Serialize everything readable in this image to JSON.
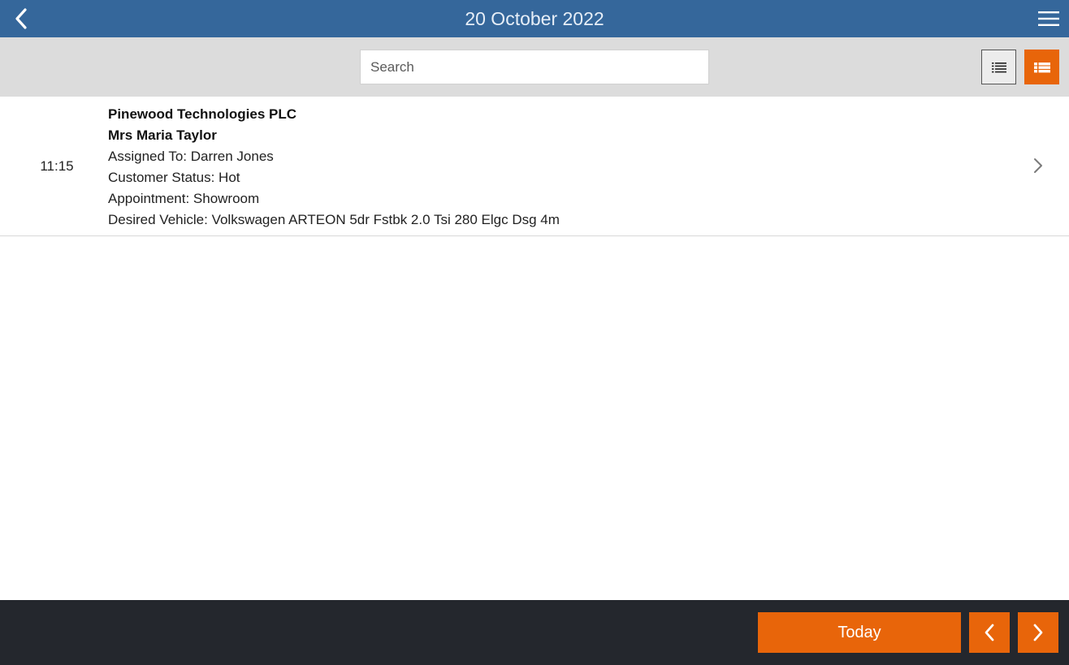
{
  "header": {
    "title": "20 October 2022",
    "back_icon": "chevron-left-icon",
    "menu_icon": "hamburger-menu-icon",
    "color": "#35679b"
  },
  "toolbar": {
    "search_placeholder": "Search",
    "list_view_icon": "compact-list-icon",
    "detail_view_icon": "detail-list-icon",
    "active_view": "detail",
    "accent_color": "#e8650a"
  },
  "appointments": [
    {
      "time": "11:15",
      "company": "Pinewood Technologies PLC",
      "customer": "Mrs Maria Taylor",
      "assigned_to": "Assigned To: Darren Jones",
      "customer_status": "Customer Status: Hot",
      "appointment": "Appointment: Showroom",
      "desired_vehicle": "Desired Vehicle: Volkswagen ARTEON 5dr Fstbk 2.0 Tsi 280 Elgc Dsg 4m",
      "chevron_icon": "chevron-right-icon"
    }
  ],
  "footer": {
    "today_label": "Today",
    "prev_icon": "chevron-left-icon",
    "next_icon": "chevron-right-icon"
  }
}
